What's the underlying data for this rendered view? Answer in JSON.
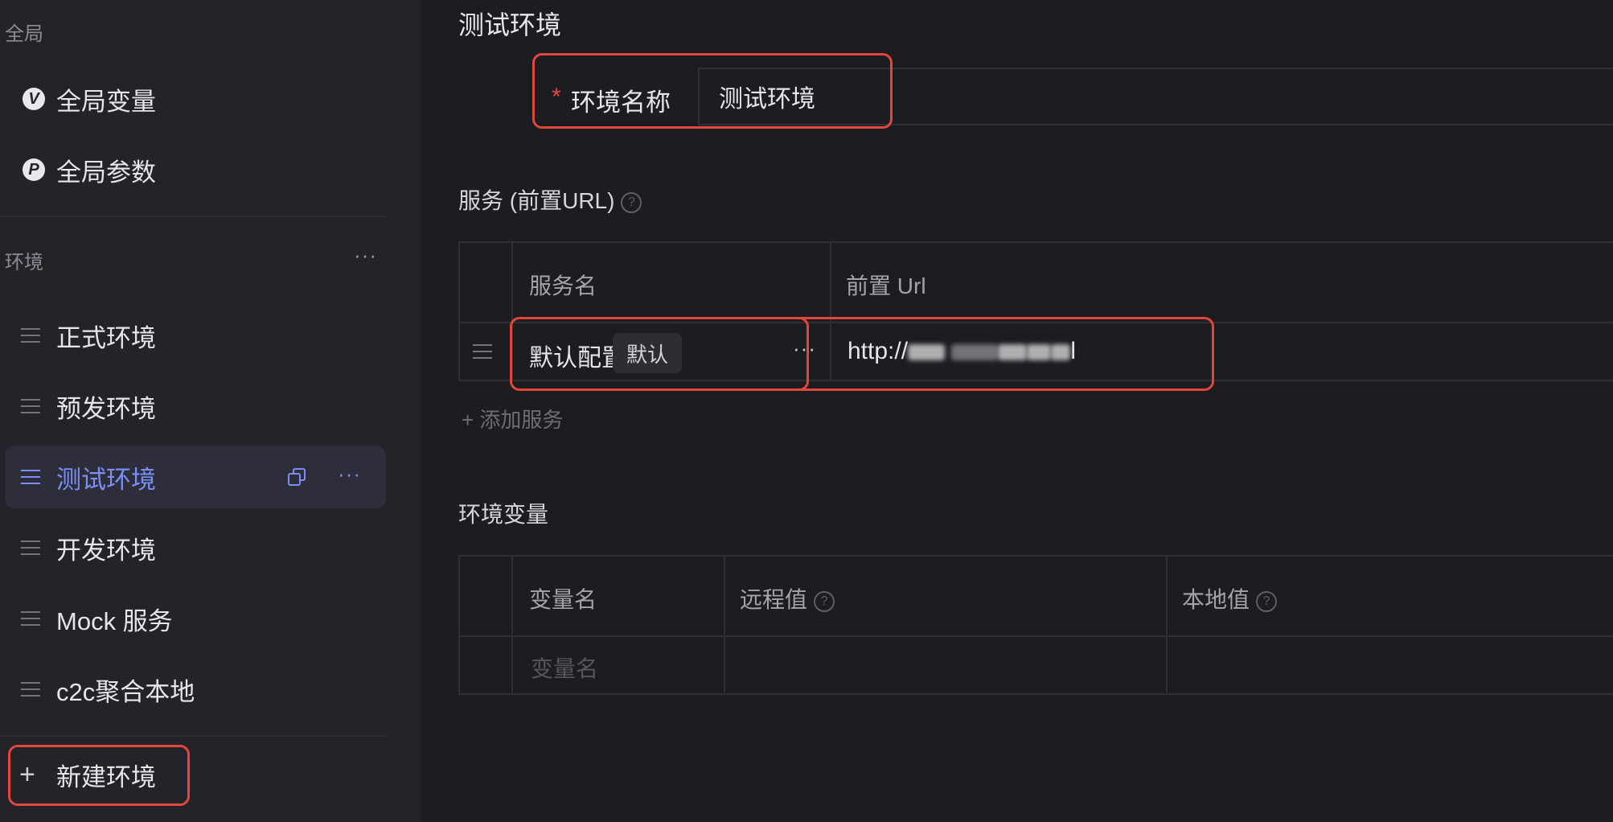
{
  "sidebar": {
    "global_section_label": "全局",
    "global_items": [
      {
        "label": "全局变量",
        "icon": "variable-icon",
        "glyph": "V"
      },
      {
        "label": "全局参数",
        "icon": "parameter-icon",
        "glyph": "P"
      }
    ],
    "env_section_label": "环境",
    "env_section_more": "···",
    "env_items": [
      {
        "label": "正式环境",
        "active": false
      },
      {
        "label": "预发环境",
        "active": false
      },
      {
        "label": "测试环境",
        "active": true
      },
      {
        "label": "开发环境",
        "active": false
      },
      {
        "label": "Mock 服务",
        "active": false
      },
      {
        "label": "c2c聚合本地",
        "active": false
      }
    ],
    "active_item_more": "···",
    "new_env_label": "新建环境",
    "new_env_icon": "+"
  },
  "main": {
    "title": "测试环境",
    "env_name": {
      "required_mark": "*",
      "label": "环境名称",
      "value": "测试环境"
    },
    "services": {
      "heading": "服务 (前置URL)",
      "help_icon": "?",
      "columns": [
        "服务名",
        "前置 Url"
      ],
      "rows": [
        {
          "name": "默认配置",
          "tag": "默认",
          "more": "···",
          "url_prefix": "http://",
          "url_suffix": "l"
        }
      ],
      "add_label": "添加服务",
      "add_icon": "+"
    },
    "variables": {
      "heading": "环境变量",
      "columns": [
        "变量名",
        "远程值",
        "本地值"
      ],
      "help_icon": "?",
      "placeholder_name": "变量名"
    }
  },
  "colors": {
    "accent": "#7b8ef5",
    "highlight_box": "#e2473b",
    "required": "#e2473b"
  }
}
